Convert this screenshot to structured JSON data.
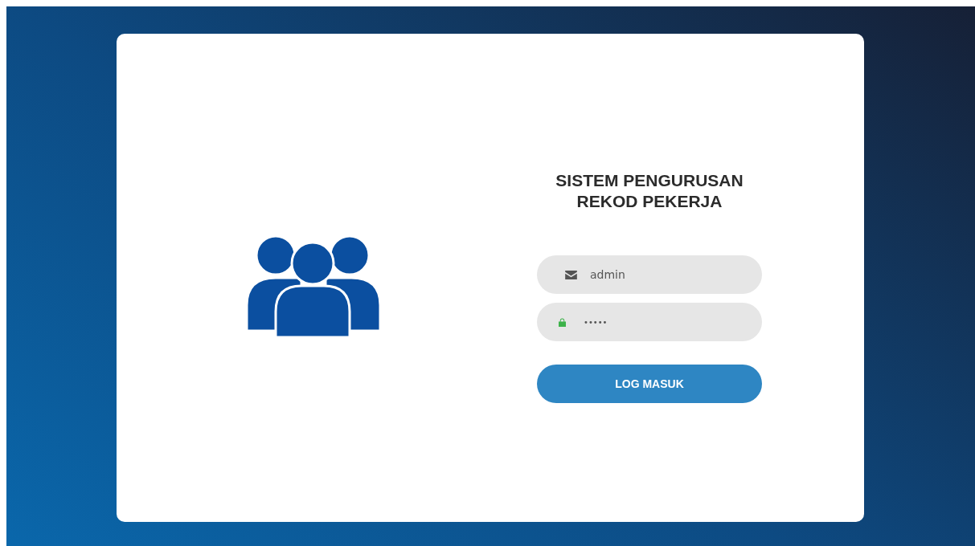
{
  "title": "SISTEM PENGURUSAN REKOD PEKERJA",
  "fields": [
    {
      "kind": "email",
      "value": "admin"
    },
    {
      "kind": "password",
      "value": "•••••"
    }
  ],
  "button": "LOG MASUK"
}
